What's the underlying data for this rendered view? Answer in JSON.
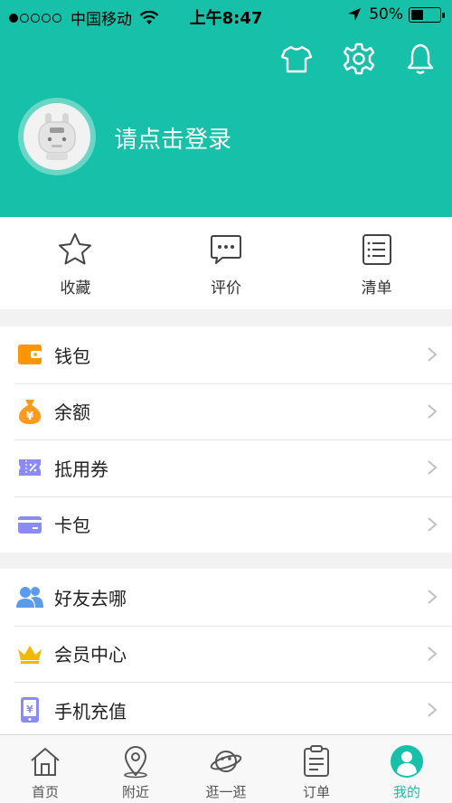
{
  "status_bar": {
    "carrier": "中国移动",
    "time": "上午8:47",
    "battery_percent": "50%",
    "battery_level": 0.5
  },
  "header": {
    "login_prompt": "请点击登录",
    "icons": [
      "shirt-icon",
      "gear-icon",
      "bell-icon"
    ]
  },
  "quick_actions": [
    {
      "label": "收藏",
      "icon": "star-icon"
    },
    {
      "label": "评价",
      "icon": "chat-bubble-icon"
    },
    {
      "label": "清单",
      "icon": "list-icon"
    }
  ],
  "menu_group_1": [
    {
      "label": "钱包",
      "icon": "wallet-icon"
    },
    {
      "label": "余额",
      "icon": "money-bag-icon"
    },
    {
      "label": "抵用券",
      "icon": "coupon-icon"
    },
    {
      "label": "卡包",
      "icon": "card-icon"
    }
  ],
  "menu_group_2": [
    {
      "label": "好友去哪",
      "icon": "friends-icon"
    },
    {
      "label": "会员中心",
      "icon": "crown-icon"
    },
    {
      "label": "手机充值",
      "icon": "phone-recharge-icon"
    }
  ],
  "tabbar": [
    {
      "label": "首页",
      "icon": "home-icon"
    },
    {
      "label": "附近",
      "icon": "location-pin-icon"
    },
    {
      "label": "逛一逛",
      "icon": "planet-icon"
    },
    {
      "label": "订单",
      "icon": "clipboard-icon"
    },
    {
      "label": "我的",
      "icon": "user-icon",
      "active": true
    }
  ],
  "colors": {
    "accent": "#17c0a8",
    "wallet": "#ff9500",
    "money_bag": "#ff9a1f",
    "coupon": "#8b8bf5",
    "card": "#8b8bf5",
    "friends": "#5b9be8",
    "crown": "#f5b800",
    "phone_recharge": "#8b8bf5"
  }
}
